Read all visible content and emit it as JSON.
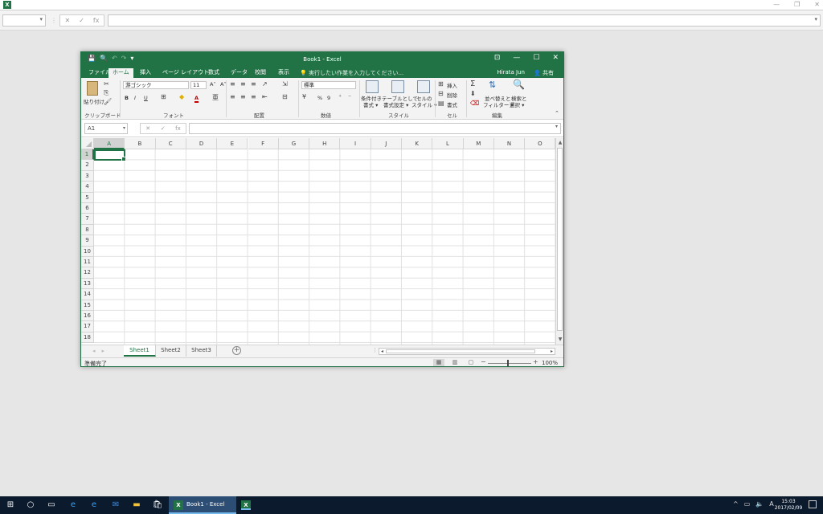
{
  "outer": {
    "icon_letter": "X",
    "ctrl_min": "—",
    "ctrl_restore": "❐",
    "ctrl_close": "✕",
    "fx_label": "fx"
  },
  "window": {
    "title": "Book1 - Excel",
    "accent": "#217346",
    "qat_save": "💾",
    "qat_preview": "🔍",
    "qat_undo": "↶",
    "qat_redo": "↷",
    "qat_more": "▾",
    "ctrl_ribbon": "⊡",
    "ctrl_min": "—",
    "ctrl_max": "☐",
    "ctrl_close": "✕"
  },
  "tabs": [
    "ファイル",
    "ホーム",
    "挿入",
    "ページ レイアウト",
    "数式",
    "データ",
    "校閲",
    "表示"
  ],
  "active_tab": "ホーム",
  "tell_me": "💡 実行したい作業を入力してください...",
  "user_name": "Hirata Jun",
  "share_label": "共有",
  "ribbon": {
    "paste_label": "貼り付け",
    "clipboard_label": "クリップボード",
    "font_name": "游ゴシック",
    "font_size": "11",
    "font_grow": "A˄",
    "font_shrink": "A˅",
    "bold": "B",
    "italic": "I",
    "underline": "U",
    "font_color": "A",
    "font_label": "フォント",
    "align_label": "配置",
    "number_format": "標準",
    "percent": "%",
    "comma": "9",
    "number_label": "数値",
    "cond_format": "条件付き\n書式",
    "cond_format_1": "条件付き",
    "cond_format_2": "書式 ▾",
    "table_format_1": "テーブルとして",
    "table_format_2": "書式設定 ▾",
    "cell_style_1": "セルの",
    "cell_style_2": "スタイル ▾",
    "style_label": "スタイル",
    "insert": "挿入",
    "delete": "削除",
    "format": "書式",
    "cells_label": "セル",
    "sort_1": "並べ替えと",
    "sort_2": "フィルター ▾",
    "find_1": "検索と",
    "find_2": "選択 ▾",
    "edit_label": "編集"
  },
  "formula_bar": {
    "name_box": "A1",
    "cancel": "✕",
    "enter": "✓",
    "fx": "fx",
    "value": ""
  },
  "grid": {
    "columns": [
      "A",
      "B",
      "C",
      "D",
      "E",
      "F",
      "G",
      "H",
      "I",
      "J",
      "K",
      "L",
      "M",
      "N",
      "O"
    ],
    "rows": [
      "1",
      "2",
      "3",
      "4",
      "5",
      "6",
      "7",
      "8",
      "9",
      "10",
      "11",
      "12",
      "13",
      "14",
      "15",
      "16",
      "17",
      "18"
    ],
    "active_cell": "A1"
  },
  "sheets": [
    "Sheet1",
    "Sheet2",
    "Sheet3"
  ],
  "active_sheet": "Sheet1",
  "add_sheet": "+",
  "status": {
    "text": "準備完了",
    "zoom": "100%",
    "zoom_level_percent": 100
  },
  "taskbar": {
    "app_label": "Book1 - Excel",
    "time": "15:03",
    "date": "2017/02/09",
    "ime": "A"
  }
}
